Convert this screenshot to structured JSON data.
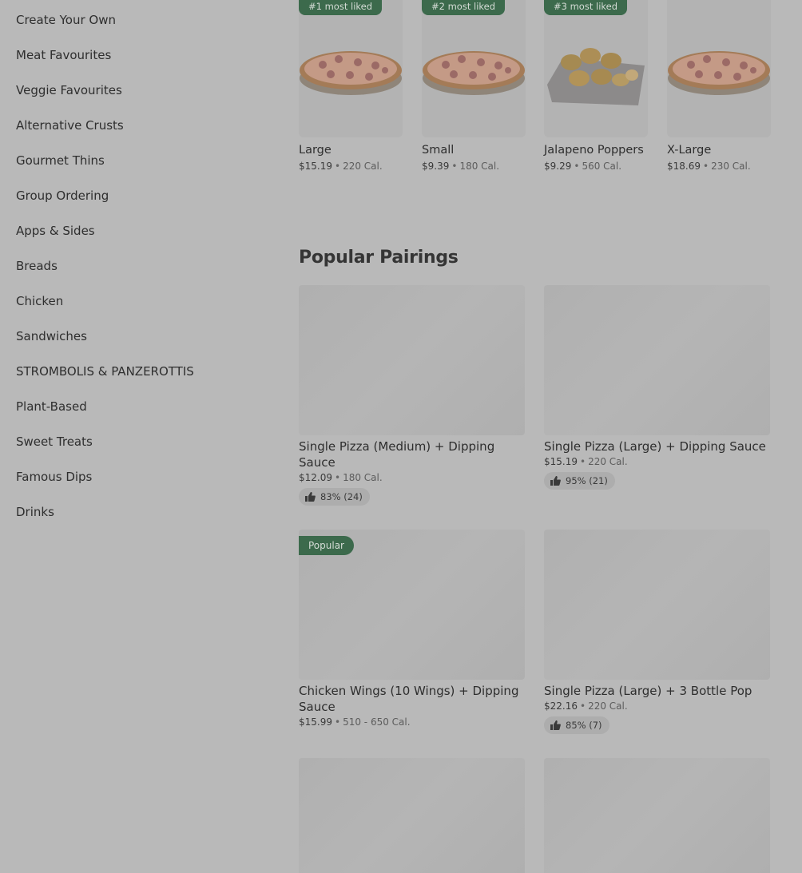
{
  "categories": [
    "Create Your Own",
    "Meat Favourites",
    "Veggie Favourites",
    "Alternative Crusts",
    "Gourmet Thins",
    "Group Ordering",
    "Apps & Sides",
    "Breads",
    "Chicken",
    "Sandwiches",
    "STROMBOLIS & PANZEROTTIS",
    "Plant-Based",
    "Sweet Treats",
    "Famous Dips",
    "Drinks"
  ],
  "most_liked": [
    {
      "badge": "#1 most liked",
      "name": "Large",
      "price": "$15.19",
      "calories": "220 Cal.",
      "image_icon": "pizza-image"
    },
    {
      "badge": "#2 most liked",
      "name": "Small",
      "price": "$9.39",
      "calories": "180 Cal.",
      "image_icon": "pizza-image"
    },
    {
      "badge": "#3 most liked",
      "name": "Jalapeno Poppers",
      "price": "$9.29",
      "calories": "560 Cal.",
      "image_icon": "jalapeno-poppers-image"
    },
    {
      "badge": "",
      "name": "X-Large",
      "price": "$18.69",
      "calories": "230 Cal.",
      "image_icon": "pizza-image"
    }
  ],
  "separator": "•",
  "pairings": {
    "title": "Popular Pairings",
    "items": [
      {
        "name": "Single Pizza (Medium) + Dipping Sauce",
        "price": "$12.09",
        "calories": "180 Cal.",
        "rating": "83% (24)",
        "badge": ""
      },
      {
        "name": "Single Pizza (Large) + Dipping Sauce",
        "price": "$15.19",
        "calories": "220 Cal.",
        "rating": "95% (21)",
        "badge": ""
      },
      {
        "name": "Chicken Wings (10 Wings) + Dipping Sauce",
        "price": "$15.99",
        "calories": "510 - 650 Cal.",
        "rating": "",
        "badge": "Popular"
      },
      {
        "name": "Single Pizza (Large) + 3 Bottle Pop",
        "price": "$22.16",
        "calories": "220 Cal.",
        "rating": "85% (7)",
        "badge": ""
      }
    ]
  },
  "colors": {
    "overlay_background": "#b9b9b9",
    "badge_green": "#3c6a4c"
  }
}
